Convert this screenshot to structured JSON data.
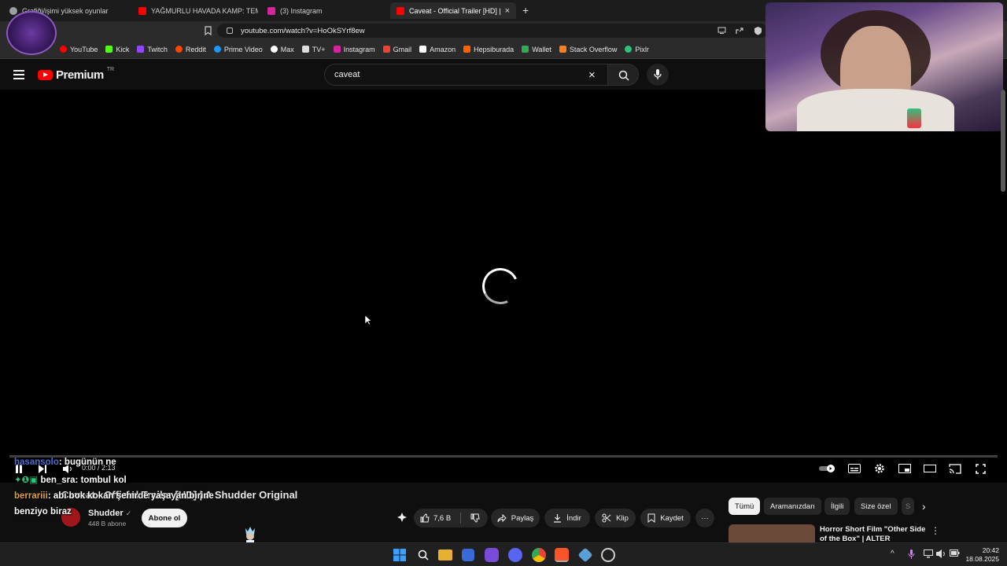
{
  "browser": {
    "tabs": [
      {
        "label": "Grafiği/işimi yüksek oyunlar",
        "favicon_color": "#9aa0a6",
        "active": false
      },
      {
        "label": "YAĞMURLU HAVADA KAMP: TEMI",
        "favicon_color": "#ff0000",
        "active": false
      },
      {
        "label": "(3) Instagram",
        "favicon_color": "#d6249f",
        "active": false
      },
      {
        "label": "Caveat - Official Trailer [HD] | A S",
        "favicon_color": "#ff0000",
        "active": true
      }
    ],
    "new_tab": "+",
    "close_tab": "×",
    "url": "youtube.com/watch?v=HoOkSYrf8ew",
    "bookmarks": [
      {
        "label": "YouTube",
        "color": "#ff0000"
      },
      {
        "label": "Kick",
        "color": "#53fc18"
      },
      {
        "label": "Twitch",
        "color": "#9146ff"
      },
      {
        "label": "Reddit",
        "color": "#ff4500"
      },
      {
        "label": "Prime Video",
        "color": "#1a98ff"
      },
      {
        "label": "Max",
        "color": "#ffffff"
      },
      {
        "label": "TV+",
        "color": "#dddddd"
      },
      {
        "label": "Instagram",
        "color": "#d6249f"
      },
      {
        "label": "Gmail",
        "color": "#ea4335"
      },
      {
        "label": "Amazon",
        "color": "#ffffff"
      },
      {
        "label": "Hepsiburada",
        "color": "#ff6000"
      },
      {
        "label": "Wallet",
        "color": "#34a853"
      },
      {
        "label": "Stack Overflow",
        "color": "#f48024"
      },
      {
        "label": "Pixlr",
        "color": "#2ec27e"
      }
    ]
  },
  "youtube": {
    "logo_text": "Premium",
    "logo_region": "TR",
    "search_value": "caveat",
    "clear_icon": "×",
    "player": {
      "timecode": "0:00 / 2:13"
    },
    "video": {
      "title": "Caveat - Official Trailer [HD] | A Shudder Original",
      "channel_name": "Shudder",
      "verified_mark": "✓",
      "subscribers": "448 B abone",
      "subscribe_label": "Abone ol",
      "like_count": "7,6 B",
      "share_label": "Paylaş",
      "download_label": "İndir",
      "clip_label": "Klip",
      "save_label": "Kaydet",
      "more_label": "···"
    },
    "chips": [
      {
        "label": "Tümü",
        "selected": true
      },
      {
        "label": "Aramanızdan",
        "selected": false
      },
      {
        "label": "İlgili",
        "selected": false
      },
      {
        "label": "Size özel",
        "selected": false
      },
      {
        "label": "S",
        "selected": false
      }
    ],
    "chip_next": "›",
    "recommendation": {
      "title": "Horror Short Film \"Other Side of the Box\" | ALTER",
      "menu": "⋮"
    }
  },
  "chat": [
    {
      "user": "hasansolo",
      "message": ": bugünün ne"
    },
    {
      "user": "ben_sra",
      "message": ": tombul kol"
    },
    {
      "user": "berrariii",
      "message": ": abi bok kokan şehirde yaşayan birine"
    },
    {
      "user": "",
      "message": "benziyo biraz"
    }
  ],
  "taskbar": {
    "time": "20:42",
    "date": "18.08.2025"
  }
}
